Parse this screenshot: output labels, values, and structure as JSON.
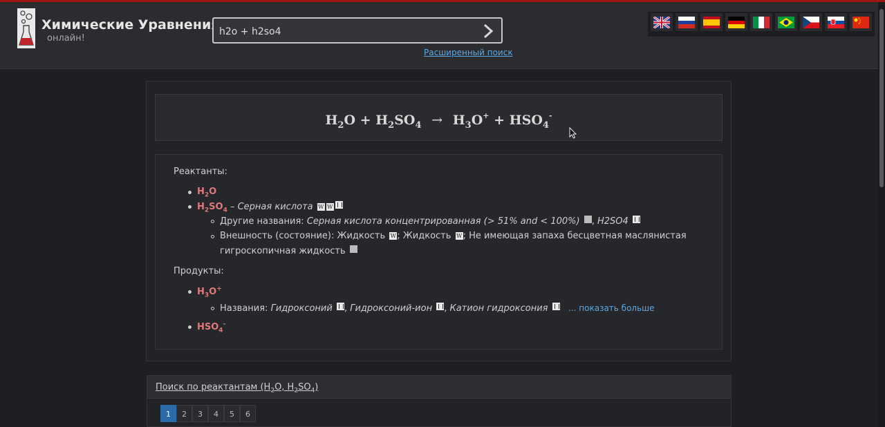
{
  "header": {
    "title": "Химические Уравнения",
    "subtitle": "онлайн!",
    "search_value": "h2o + h2so4",
    "advanced_search": "Расширенный поиск"
  },
  "languages": [
    "English",
    "Русский",
    "Español",
    "Deutsch",
    "Italiano",
    "Português",
    "Čeština",
    "Slovenčina",
    "中文"
  ],
  "equation": {
    "r1": "H",
    "r1_sub": "2",
    "r1_tail": "O",
    "plus1": "+",
    "r2": "H",
    "r2_sub1": "2",
    "r2_mid": "SO",
    "r2_sub2": "4",
    "arrow": "→",
    "p1": "H",
    "p1_sub": "3",
    "p1_tail": "O",
    "p1_sup": "+",
    "plus2": "+",
    "p2": "HSO",
    "p2_sub": "4",
    "p2_sup": "-"
  },
  "reactants": {
    "label": "Реактанты:",
    "h2o": {
      "a": "H",
      "sub": "2",
      "b": "O"
    },
    "h2so4": {
      "a": "H",
      "sub1": "2",
      "b": "SO",
      "sub2": "4",
      "dash": " – ",
      "name": "Серная кислота"
    },
    "other_names_label": "Другие названия: ",
    "other_names_value": "Серная кислота концентрированная (> 51% and < 100%)",
    "other_names_sep": ", ",
    "other_names_value2": "H2SO4",
    "appearance_label": "Внешность (состояние): ",
    "appearance_1": "Жидкость",
    "appearance_sep": "; ",
    "appearance_2": "Жидкость",
    "appearance_3": "Не имеющая запаха бесцветная маслянистая",
    "appearance_3b": "гигроскопичная жидкость"
  },
  "products": {
    "label": "Продукты:",
    "h3o": {
      "a": "H",
      "sub": "3",
      "b": "O",
      "sup": "+"
    },
    "names_label": "Названия: ",
    "name1": "Гидроксоний",
    "name2": "Гидроксоний-ион",
    "name3": "Катион гидроксония",
    "sep": ", ",
    "show_more": "... показать больше",
    "hso4": {
      "a": "HSO",
      "sub": "4",
      "sup": "-"
    }
  },
  "search_by_reactants": {
    "prefix": "Поиск по реактантам (H",
    "sub1": "2",
    "mid": "O, H",
    "sub2": "2",
    "mid2": "SO",
    "sub3": "4",
    "suffix": ")"
  },
  "pagination": [
    "1",
    "2",
    "3",
    "4",
    "5",
    "6"
  ]
}
